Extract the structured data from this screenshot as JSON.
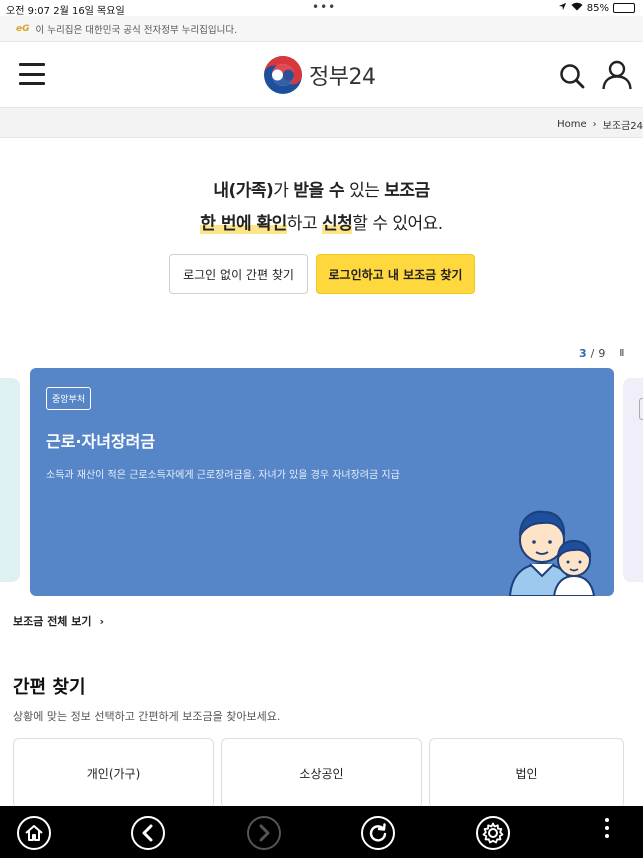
{
  "status_bar": {
    "time_date": "오전 9:07   2월 16일 목요일",
    "dots": "•••",
    "battery": "85%",
    "battery_level": 0.85
  },
  "gov_banner": {
    "badge": "eG",
    "text": "이 누리집은 대한민국 공식 전자정부 누리집입니다."
  },
  "header": {
    "logo_text": "정부24",
    "menu_icon": "hamburger-icon",
    "search_icon": "search-icon",
    "user_icon": "user-icon"
  },
  "breadcrumb": {
    "home": "Home",
    "separator": "›",
    "current": "보조금24"
  },
  "hero": {
    "line1": {
      "p1": "내(가족)",
      "p2": "가 ",
      "p3": "받을 수",
      "p4": " 있는 ",
      "p5": "보조금"
    },
    "line2": {
      "p1": "한 번에 확인",
      "p2": "하고 ",
      "p3": "신청",
      "p4": "할 수 있어요."
    }
  },
  "buttons": {
    "guest": "로그인 없이 간편 찾기",
    "login": "로그인하고 내 보조금 찾기"
  },
  "pager": {
    "current": "3",
    "separator": "/",
    "total": "9",
    "pause": "II"
  },
  "card": {
    "tag": "중앙부처",
    "title": "근로·자녀장려금",
    "desc": "소득과 재산이 적은 근로소득자에게 근로장려금을, 자녀가 있을 경우 자녀장려금 지급",
    "bg_color": "#5686c8"
  },
  "all_link": {
    "label": "보조금 전체 보기",
    "arrow": "›"
  },
  "quick_find": {
    "title": "간편 찾기",
    "subtitle": "상황에 맞는 정보 선택하고 간편하게 보조금을 찾아보세요.",
    "categories": [
      "개인(가구)",
      "소상공인",
      "법인"
    ]
  },
  "toolbar": {
    "icons": [
      "home-icon",
      "back-icon",
      "forward-icon",
      "reload-icon",
      "settings-icon",
      "more-icon"
    ]
  },
  "colors": {
    "accent_yellow": "#ffd83d",
    "accent_blue": "#2b6cb5",
    "logo_red": "#d9363e",
    "logo_blue": "#1e4f9c"
  }
}
